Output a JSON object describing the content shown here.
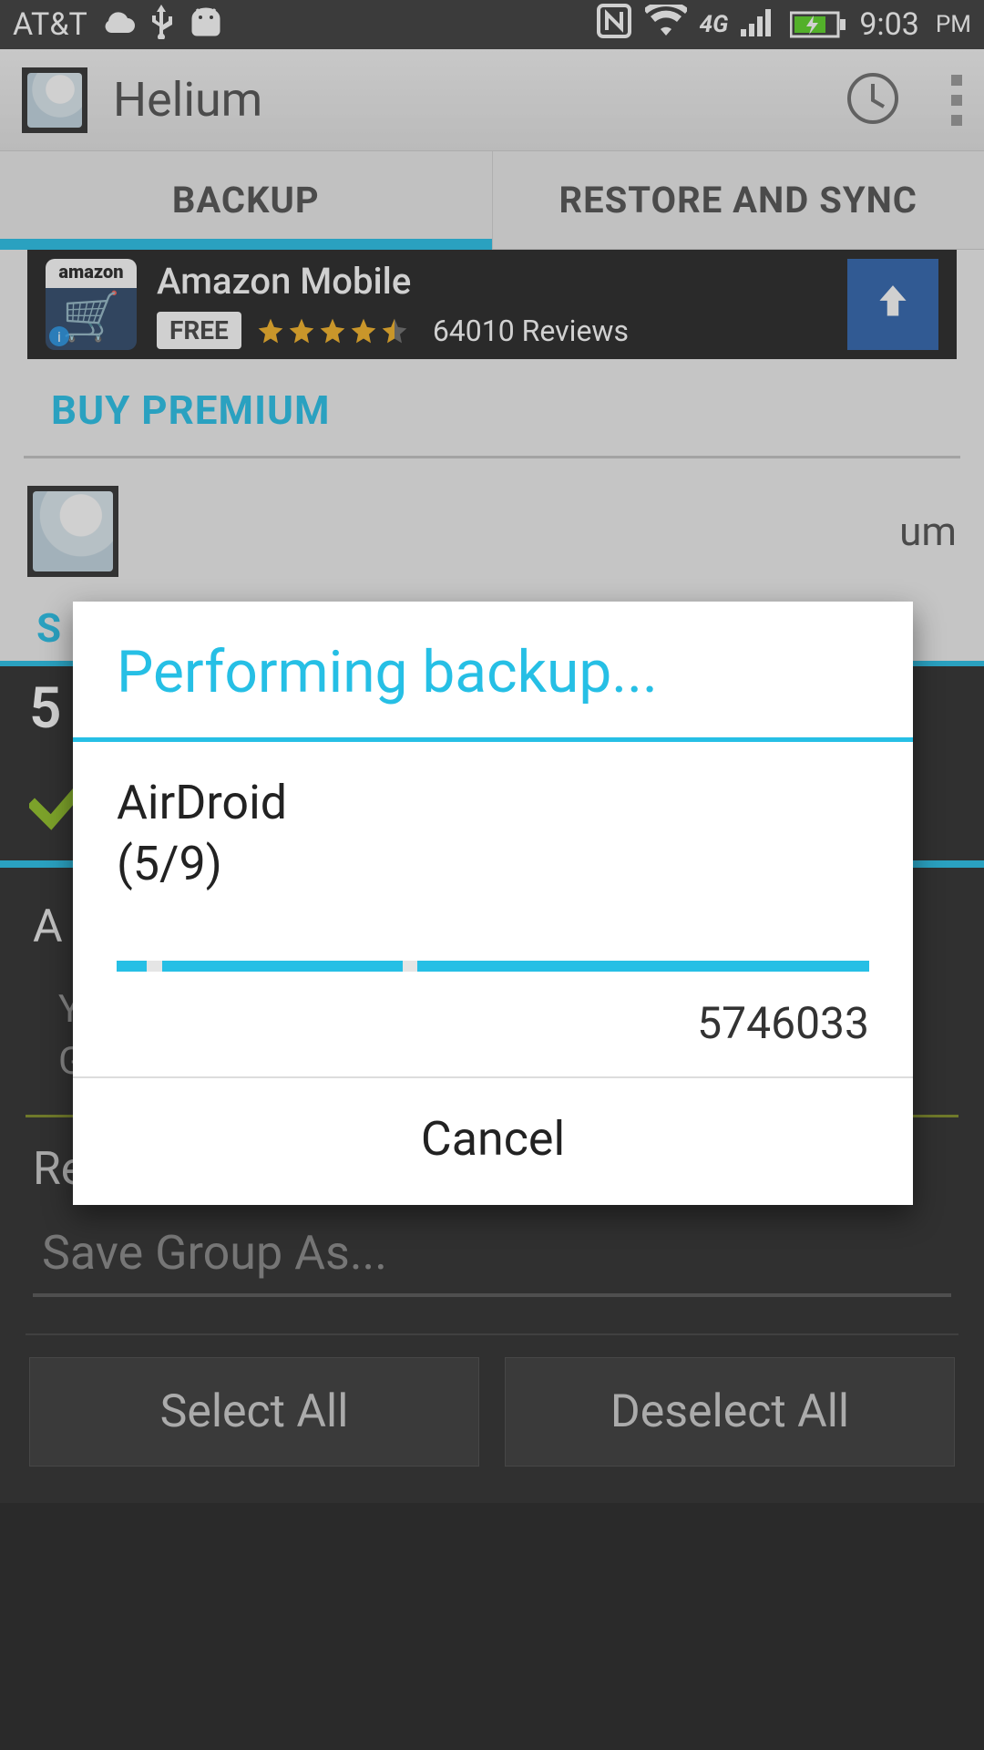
{
  "statusbar": {
    "carrier": "AT&T",
    "time": "9:03",
    "ampm": "PM"
  },
  "app": {
    "title": "Helium"
  },
  "tabs": {
    "backup": "BACKUP",
    "restore": "RESTORE AND SYNC"
  },
  "ad": {
    "brand": "amazon",
    "title": "Amazon Mobile",
    "badge": "FREE",
    "reviews": "64010 Reviews"
  },
  "sections": {
    "buy_premium": "BUY PREMIUM",
    "device_suffix": "um",
    "letter": "S"
  },
  "dark": {
    "selected_count": "5",
    "appdata_title": "A",
    "appdata_sub": "You will be prompted to download the app from Google Play before restoring.",
    "remember": "Remember Group of Apps",
    "save_group_placeholder": "Save Group As...",
    "select_all": "Select All",
    "deselect_all": "Deselect All"
  },
  "dialog": {
    "title": "Performing backup...",
    "app": "AirDroid",
    "progress_label": "(5/9)",
    "bytes": "5746033",
    "cancel": "Cancel"
  }
}
